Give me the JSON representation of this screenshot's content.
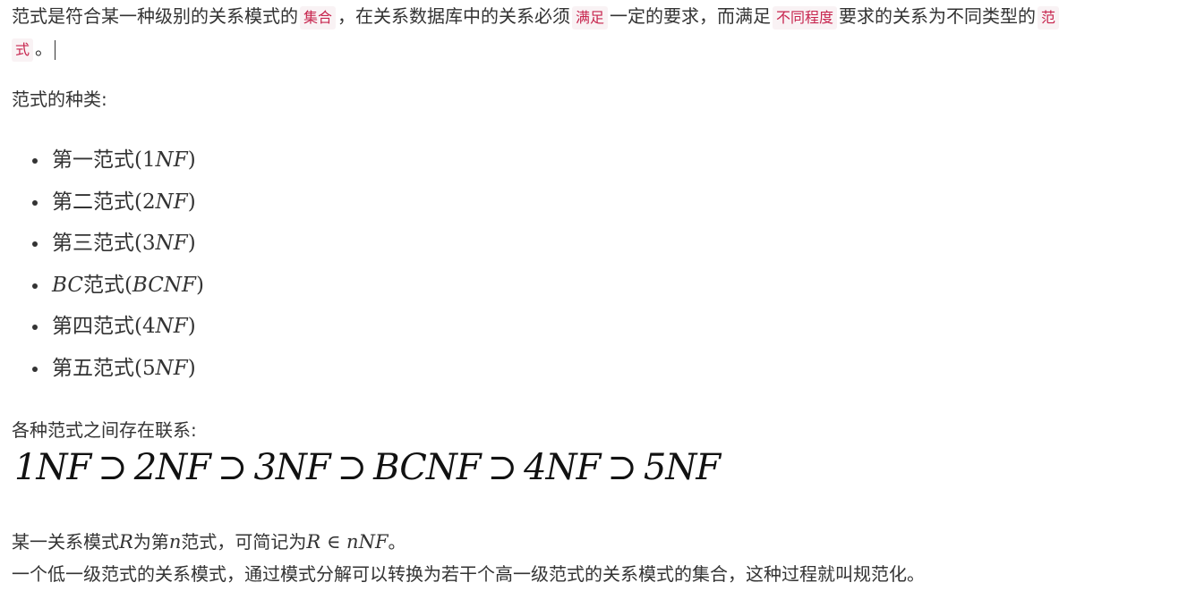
{
  "intro": {
    "t1": "范式是符合某一种级别的关系模式的",
    "c1": "集合",
    "t2": "，在关系数据库中的关系必须",
    "c2": "满足",
    "t3": "一定的要求，而满足",
    "c3": "不同程度",
    "t4": "要求的关系为不同类型的",
    "c4a": "范",
    "c4b": "式",
    "t5": "。"
  },
  "kinds_heading": "范式的种类:",
  "kinds": [
    {
      "prefix": "第一范式",
      "open": "(",
      "num": "1",
      "it": "NF",
      "close": ")"
    },
    {
      "prefix": "第二范式",
      "open": "(",
      "num": "2",
      "it": "NF",
      "close": ")"
    },
    {
      "prefix": "第三范式",
      "open": "(",
      "num": "3",
      "it": "NF",
      "close": ")"
    },
    {
      "prefix_it": "BC",
      "prefix": "范式",
      "open": "(",
      "num": "",
      "it": "BCNF",
      "close": ")"
    },
    {
      "prefix": "第四范式",
      "open": "(",
      "num": "4",
      "it": "NF",
      "close": ")"
    },
    {
      "prefix": "第五范式",
      "open": "(",
      "num": "5",
      "it": "NF",
      "close": ")"
    }
  ],
  "relation_heading": "各种范式之间存在联系:",
  "chain": [
    "1NF",
    "⊃",
    "2NF",
    "⊃",
    "3NF",
    "⊃",
    "BCNF",
    "⊃",
    "4NF",
    "⊃",
    "5NF"
  ],
  "line1": {
    "a": "某一关系模式",
    "R": "R",
    "b": "为第",
    "n": "n",
    "c": "范式，可简记为",
    "expr": "R ∈ nNF",
    "d": "。"
  },
  "line2": "一个低一级范式的关系模式，通过模式分解可以转换为若干个高一级范式的关系模式的集合，这种过程就叫规范化。"
}
